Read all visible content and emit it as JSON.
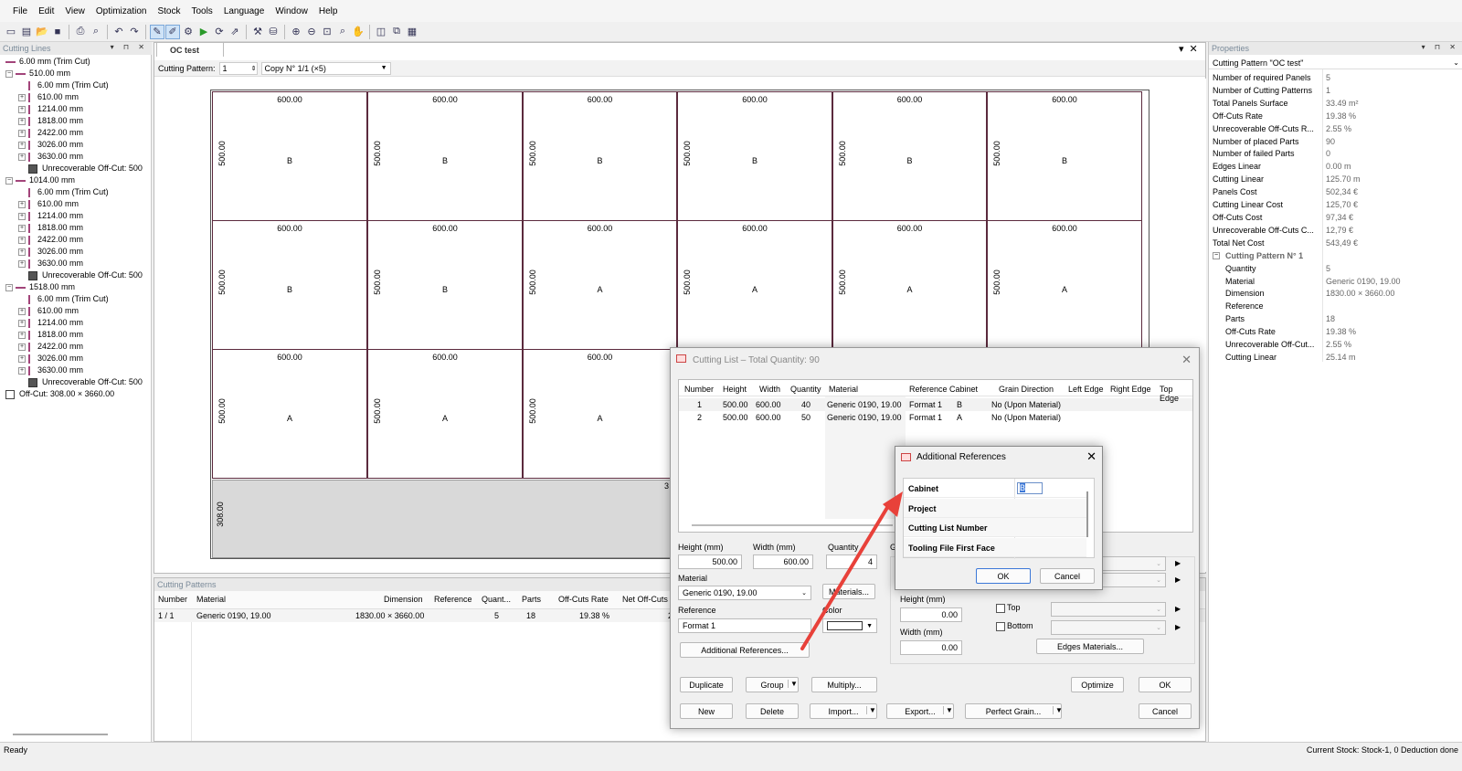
{
  "menu": [
    "File",
    "Edit",
    "View",
    "Optimization",
    "Stock",
    "Tools",
    "Language",
    "Window",
    "Help"
  ],
  "left_pane": {
    "title": "Cutting Lines",
    "tree": [
      {
        "t": "6.00 mm (Trim Cut)",
        "lvl": 0,
        "kind": "hbar"
      },
      {
        "t": "510.00 mm",
        "lvl": 0,
        "kind": "hbar",
        "exp": "−"
      },
      {
        "t": "6.00 mm (Trim Cut)",
        "lvl": 1,
        "kind": "vbar"
      },
      {
        "t": "610.00 mm",
        "lvl": 1,
        "kind": "vbar",
        "exp": "+"
      },
      {
        "t": "1214.00 mm",
        "lvl": 1,
        "kind": "vbar",
        "exp": "+"
      },
      {
        "t": "1818.00 mm",
        "lvl": 1,
        "kind": "vbar",
        "exp": "+"
      },
      {
        "t": "2422.00 mm",
        "lvl": 1,
        "kind": "vbar",
        "exp": "+"
      },
      {
        "t": "3026.00 mm",
        "lvl": 1,
        "kind": "vbar",
        "exp": "+"
      },
      {
        "t": "3630.00 mm",
        "lvl": 1,
        "kind": "vbar",
        "exp": "+"
      },
      {
        "t": "Unrecoverable Off-Cut: 500",
        "lvl": 1,
        "kind": "gsq"
      },
      {
        "t": "1014.00 mm",
        "lvl": 0,
        "kind": "hbar",
        "exp": "−"
      },
      {
        "t": "6.00 mm (Trim Cut)",
        "lvl": 1,
        "kind": "vbar"
      },
      {
        "t": "610.00 mm",
        "lvl": 1,
        "kind": "vbar",
        "exp": "+"
      },
      {
        "t": "1214.00 mm",
        "lvl": 1,
        "kind": "vbar",
        "exp": "+"
      },
      {
        "t": "1818.00 mm",
        "lvl": 1,
        "kind": "vbar",
        "exp": "+"
      },
      {
        "t": "2422.00 mm",
        "lvl": 1,
        "kind": "vbar",
        "exp": "+"
      },
      {
        "t": "3026.00 mm",
        "lvl": 1,
        "kind": "vbar",
        "exp": "+"
      },
      {
        "t": "3630.00 mm",
        "lvl": 1,
        "kind": "vbar",
        "exp": "+"
      },
      {
        "t": "Unrecoverable Off-Cut: 500",
        "lvl": 1,
        "kind": "gsq"
      },
      {
        "t": "1518.00 mm",
        "lvl": 0,
        "kind": "hbar",
        "exp": "−"
      },
      {
        "t": "6.00 mm (Trim Cut)",
        "lvl": 1,
        "kind": "vbar"
      },
      {
        "t": "610.00 mm",
        "lvl": 1,
        "kind": "vbar",
        "exp": "+"
      },
      {
        "t": "1214.00 mm",
        "lvl": 1,
        "kind": "vbar",
        "exp": "+"
      },
      {
        "t": "1818.00 mm",
        "lvl": 1,
        "kind": "vbar",
        "exp": "+"
      },
      {
        "t": "2422.00 mm",
        "lvl": 1,
        "kind": "vbar",
        "exp": "+"
      },
      {
        "t": "3026.00 mm",
        "lvl": 1,
        "kind": "vbar",
        "exp": "+"
      },
      {
        "t": "3630.00 mm",
        "lvl": 1,
        "kind": "vbar",
        "exp": "+"
      },
      {
        "t": "Unrecoverable Off-Cut: 500",
        "lvl": 1,
        "kind": "gsq"
      },
      {
        "t": "Off-Cut: 308.00 × 3660.00",
        "lvl": 0,
        "kind": "osq"
      }
    ]
  },
  "doc": {
    "tab": "OC test",
    "cp_label": "Cutting Pattern:",
    "cp_num": "1",
    "cp_copy": "Copy N° 1/1 (×5)",
    "rows": [
      [
        "B",
        "B",
        "B",
        "B",
        "B",
        "B"
      ],
      [
        "B",
        "B",
        "A",
        "A",
        "A",
        "A"
      ],
      [
        "A",
        "A",
        "A",
        "",
        "",
        ""
      ]
    ],
    "width_label": "600.00",
    "height_label": "500.00",
    "offcut_label": "308.00",
    "hidden_width": "3"
  },
  "cutting_patterns": {
    "title": "Cutting Patterns",
    "headers": [
      "Number",
      "Material",
      "Dimension",
      "Reference",
      "Quant...",
      "Parts",
      "Off-Cuts Rate",
      "Net Off-Cuts"
    ],
    "row": [
      "1 / 1",
      "Generic 0190, 19.00",
      "1830.00 × 3660.00",
      "",
      "5",
      "18",
      "19.38 %",
      "2"
    ]
  },
  "properties": {
    "title": "Properties",
    "selector": "Cutting Pattern \"OC test\"",
    "rows": [
      [
        "Number of required Panels",
        "5"
      ],
      [
        "Number of Cutting Patterns",
        "1"
      ],
      [
        "Total Panels Surface",
        "33.49 m²"
      ],
      [
        "Off-Cuts Rate",
        "19.38 %"
      ],
      [
        "Unrecoverable Off-Cuts R...",
        "2.55 %"
      ],
      [
        "Number of placed Parts",
        "90"
      ],
      [
        "Number of failed Parts",
        "0"
      ],
      [
        "Edges Linear",
        "0.00 m"
      ],
      [
        "Cutting Linear",
        "125.70 m"
      ],
      [
        "Panels Cost",
        "502,34 €"
      ],
      [
        "Cutting Linear Cost",
        "125,70 €"
      ],
      [
        "Off-Cuts Cost",
        "97,34 €"
      ],
      [
        "Unrecoverable Off-Cuts C...",
        "12,79 €"
      ],
      [
        "Total Net Cost",
        "543,49 €"
      ]
    ],
    "group": "Cutting Pattern N° 1",
    "sub": [
      [
        "Quantity",
        "5"
      ],
      [
        "Material",
        "Generic 0190, 19.00"
      ],
      [
        "Dimension",
        "1830.00 × 3660.00"
      ],
      [
        "Reference",
        ""
      ],
      [
        "Parts",
        "18"
      ],
      [
        "Off-Cuts Rate",
        "19.38 %"
      ],
      [
        "Unrecoverable Off-Cut...",
        "2.55 %"
      ],
      [
        "Cutting Linear",
        "25.14 m"
      ]
    ]
  },
  "status": {
    "left": "Ready",
    "right": "Current Stock: Stock-1, 0 Deduction done"
  },
  "cutting_list": {
    "title": "Cutting List – Total Quantity: 90",
    "headers": [
      "Number",
      "Height",
      "Width",
      "Quantity",
      "Material",
      "Reference",
      "Cabinet",
      "Grain Direction",
      "Left Edge",
      "Right Edge",
      "Top Edge"
    ],
    "rows": [
      [
        "1",
        "500.00",
        "600.00",
        "40",
        "Generic 0190, 19.00",
        "Format 1",
        "B",
        "No (Upon Material)"
      ],
      [
        "2",
        "500.00",
        "600.00",
        "50",
        "Generic 0190, 19.00",
        "Format 1",
        "A",
        "No (Upon Material)"
      ]
    ],
    "height_label": "Height (mm)",
    "height": "500.00",
    "width_label": "Width (mm)",
    "width": "600.00",
    "qty_label": "Quantity",
    "qty": "4",
    "g_label": "G",
    "material_label": "Material",
    "material": "Generic 0190, 19.00",
    "materials_btn": "Materials...",
    "reference_label": "Reference",
    "reference": "Format 1",
    "color_label": "Color",
    "addref_btn": "Additional References...",
    "height2_label": "Height (mm)",
    "height2": "0.00",
    "width2_label": "Width (mm)",
    "width2": "0.00",
    "top": "Top",
    "bottom": "Bottom",
    "edges_btn": "Edges Materials...",
    "buttons": {
      "duplicate": "Duplicate",
      "group": "Group",
      "multiply": "Multiply...",
      "optimize": "Optimize",
      "ok": "OK",
      "new": "New",
      "delete": "Delete",
      "import": "Import...",
      "export": "Export...",
      "grain": "Perfect Grain...",
      "cancel": "Cancel"
    }
  },
  "additional_refs": {
    "title": "Additional References",
    "fields": [
      "Cabinet",
      "Project",
      "Cutting List Number",
      "Tooling File First Face"
    ],
    "cabinet_value": "B",
    "ok": "OK",
    "cancel": "Cancel"
  },
  "colors": {
    "accent": "#a2447a",
    "arrow": "#e8413a"
  }
}
